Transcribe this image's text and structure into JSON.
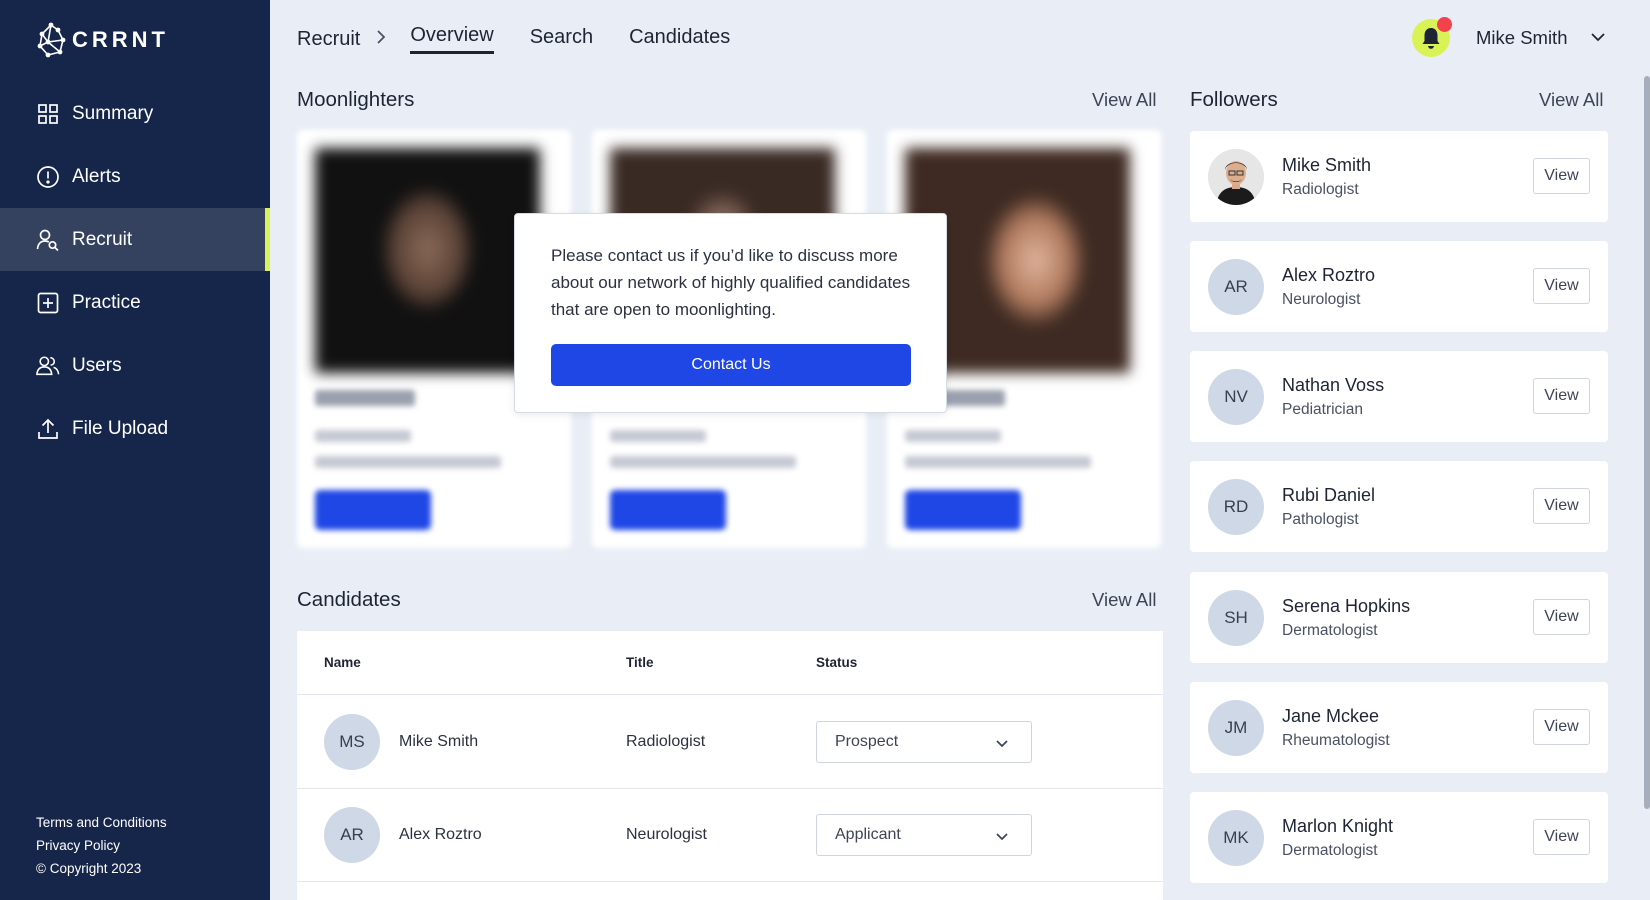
{
  "app": {
    "logo_text": "CRRNT"
  },
  "sidebar": {
    "items": [
      {
        "label": "Summary",
        "icon": "grid-icon"
      },
      {
        "label": "Alerts",
        "icon": "alert-circle-icon"
      },
      {
        "label": "Recruit",
        "icon": "user-search-icon",
        "active": true
      },
      {
        "label": "Practice",
        "icon": "plus-square-icon"
      },
      {
        "label": "Users",
        "icon": "users-icon"
      },
      {
        "label": "File Upload",
        "icon": "upload-icon"
      }
    ],
    "footer": {
      "terms": "Terms and Conditions",
      "privacy": "Privacy Policy",
      "copyright": "© Copyright 2023"
    }
  },
  "header": {
    "breadcrumb_root": "Recruit",
    "tabs": [
      {
        "label": "Overview",
        "active": true
      },
      {
        "label": "Search"
      },
      {
        "label": "Candidates"
      }
    ],
    "user_name": "Mike Smith",
    "accent_color": "#d9f255",
    "notification_dot_color": "#f2424b"
  },
  "moonlighters": {
    "title": "Moonlighters",
    "view_all": "View All",
    "popup": {
      "text": "Please contact us if you’d like to discuss more about our network of highly qualified candidates that are open to moonlighting.",
      "button": "Contact Us"
    }
  },
  "candidates": {
    "title": "Candidates",
    "view_all": "View All",
    "columns": {
      "name": "Name",
      "title": "Title",
      "status": "Status"
    },
    "rows": [
      {
        "initials": "MS",
        "name": "Mike Smith",
        "title": "Radiologist",
        "status": "Prospect"
      },
      {
        "initials": "AR",
        "name": "Alex Roztro",
        "title": "Neurologist",
        "status": "Applicant"
      }
    ]
  },
  "followers": {
    "title": "Followers",
    "view_all": "View All",
    "view_label": "View",
    "items": [
      {
        "initials": "",
        "name": "Mike Smith",
        "title": "Radiologist",
        "has_photo": true
      },
      {
        "initials": "AR",
        "name": "Alex Roztro",
        "title": "Neurologist"
      },
      {
        "initials": "NV",
        "name": "Nathan Voss",
        "title": "Pediatrician"
      },
      {
        "initials": "RD",
        "name": "Rubi Daniel",
        "title": "Pathologist"
      },
      {
        "initials": "SH",
        "name": "Serena Hopkins",
        "title": "Dermatologist"
      },
      {
        "initials": "JM",
        "name": "Jane Mckee",
        "title": "Rheumatologist"
      },
      {
        "initials": "MK",
        "name": "Marlon Knight",
        "title": "Dermatologist"
      }
    ]
  },
  "colors": {
    "sidebar_bg": "#16254a",
    "primary_button": "#1f47e6",
    "page_bg": "#e9eef6"
  }
}
